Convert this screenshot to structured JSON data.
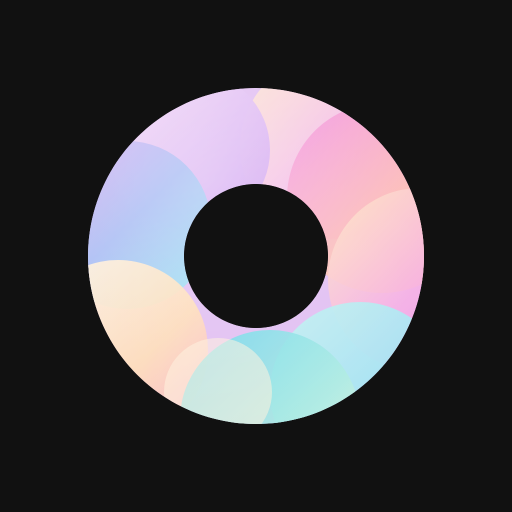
{
  "app_icon": {
    "icon": "ring-logo-icon",
    "style": "pastel gradient ring of overlapping translucent circles on a black background",
    "colors": {
      "background": "#111111",
      "hole": "#111111",
      "palette": [
        "#F7E8FF",
        "#E98BE0",
        "#FFE066",
        "#F8A6E8",
        "#9EE8F2",
        "#FFF2D6",
        "#FFD6A8",
        "#4FD3E6",
        "#C6A7F5"
      ]
    }
  }
}
